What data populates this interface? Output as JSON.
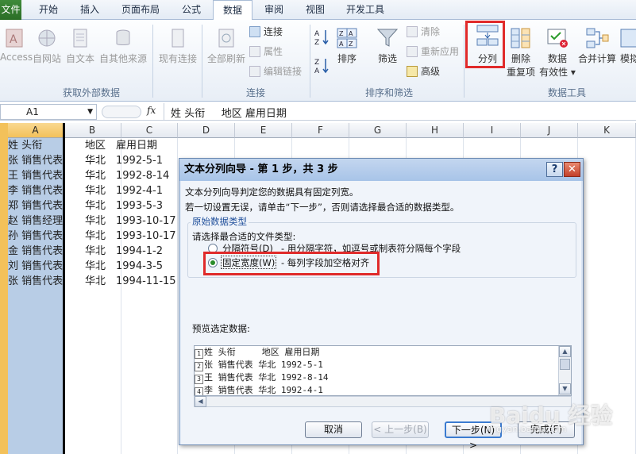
{
  "tabs": [
    "文件",
    "开始",
    "插入",
    "页面布局",
    "公式",
    "数据",
    "审阅",
    "视图",
    "开发工具"
  ],
  "ribbon": {
    "ext": {
      "access": "Access",
      "web": "自网站",
      "text": "自文本",
      "other": "自其他来源",
      "existing": "现有连接",
      "group": "获取外部数据"
    },
    "conn": {
      "refresh_all": "全部刷新",
      "connections": "连接",
      "properties": "属性",
      "edit_links": "编辑链接",
      "group": "连接"
    },
    "sort": {
      "sort": "排序",
      "filter": "筛选",
      "clear": "清除",
      "reapply": "重新应用",
      "advanced": "高级",
      "group": "排序和筛选"
    },
    "tools": {
      "split": "分列",
      "remove_dup_1": "删除",
      "remove_dup_2": "重复项",
      "validation_1": "数据",
      "validation_2": "有效性",
      "consolidate": "合并计算",
      "whatif": "模拟",
      "group": "数据工具"
    }
  },
  "formula_bar": {
    "name_box": "A1",
    "fx": "fx",
    "content": "姓 头衔     地区 雇用日期"
  },
  "columns": [
    "A",
    "B",
    "C",
    "D",
    "E",
    "F",
    "G",
    "H",
    "I",
    "J",
    "K"
  ],
  "rows": [
    {
      "a": "姓 头衔",
      "b": "地区",
      "c": "雇用日期"
    },
    {
      "a": "张 销售代表",
      "b": "华北",
      "c": "1992-5-1"
    },
    {
      "a": "王 销售代表",
      "b": "华北",
      "c": "1992-8-14"
    },
    {
      "a": "李 销售代表",
      "b": "华北",
      "c": "1992-4-1"
    },
    {
      "a": "郑 销售代表",
      "b": "华北",
      "c": "1993-5-3"
    },
    {
      "a": "赵 销售经理",
      "b": "华北",
      "c": "1993-10-17"
    },
    {
      "a": "孙 销售代表",
      "b": "华北",
      "c": "1993-10-17"
    },
    {
      "a": "金 销售代表",
      "b": "华北",
      "c": "1994-1-2"
    },
    {
      "a": "刘 销售代表",
      "b": "华北",
      "c": "1994-3-5"
    },
    {
      "a": "张 销售代表",
      "b": "华北",
      "c": "1994-11-15"
    }
  ],
  "dialog": {
    "title": "文本分列向导 - 第 1 步，共 3 步",
    "help": "?",
    "close": "✕",
    "line1": "文本分列向导判定您的数据具有固定列宽。",
    "line2": "若一切设置无误，请单击“下一步”，否则请选择最合适的数据类型。",
    "group_label": "原始数据类型",
    "prompt": "请选择最合适的文件类型:",
    "opt_delim": "分隔符号(D)",
    "opt_delim_desc": "- 用分隔字符，如逗号或制表符分隔每个字段",
    "opt_fixed": "固定宽度(W)",
    "opt_fixed_desc": "- 每列字段加空格对齐",
    "preview_label": "预览选定数据:",
    "preview": [
      {
        "n": "1",
        "t": "姓 头衔     地区 雇用日期"
      },
      {
        "n": "2",
        "t": "张 销售代表 华北 1992-5-1"
      },
      {
        "n": "3",
        "t": "王 销售代表 华北 1992-8-14"
      },
      {
        "n": "4",
        "t": "李 销售代表 华北 1992-4-1"
      }
    ],
    "buttons": {
      "cancel": "取消",
      "back": "< 上一步(B)",
      "next": "下一步(N) >",
      "finish": "完成(F)"
    }
  },
  "watermark": {
    "main": "Baidu 经验",
    "sub": "jingyan.baidu.com"
  }
}
